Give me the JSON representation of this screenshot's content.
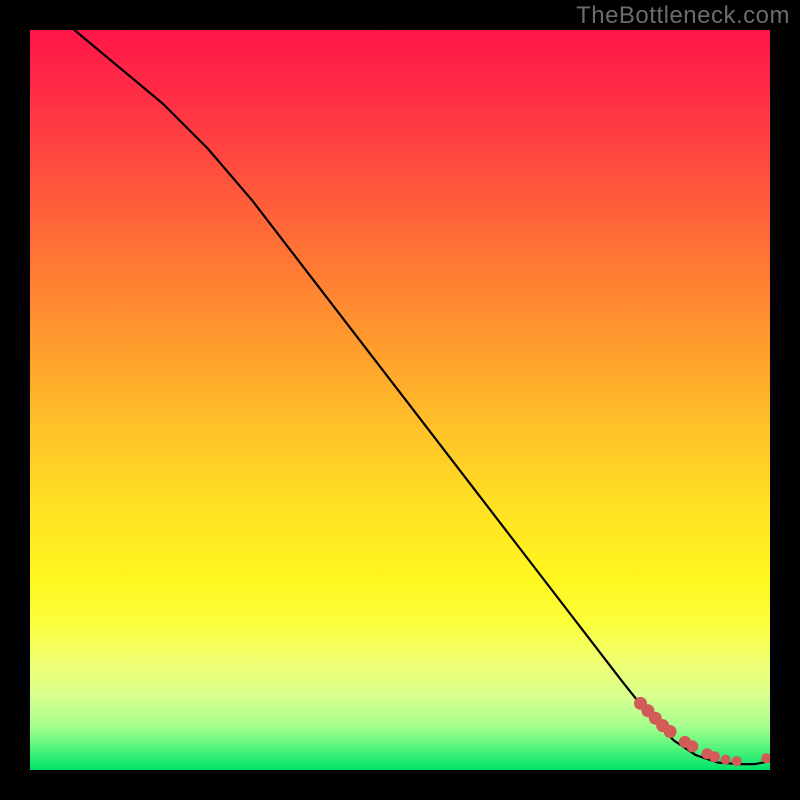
{
  "watermark": "TheBottleneck.com",
  "chart_data": {
    "type": "line",
    "title": "",
    "xlabel": "",
    "ylabel": "",
    "xlim": [
      0,
      100
    ],
    "ylim": [
      0,
      100
    ],
    "series": [
      {
        "name": "curve",
        "x": [
          0,
          6,
          12,
          18,
          24,
          30,
          40,
          50,
          60,
          70,
          80,
          84,
          87,
          90,
          93,
          96,
          98,
          100
        ],
        "y": [
          105,
          100,
          95,
          90,
          84,
          77,
          64,
          51,
          38,
          25,
          12,
          7,
          4,
          2,
          1,
          0.8,
          0.8,
          1.2
        ]
      }
    ],
    "markers": {
      "name": "dots",
      "color": "#d25a57",
      "x": [
        82.5,
        83.5,
        84.5,
        85.5,
        86.5,
        88.5,
        89.5,
        91.5,
        92.5,
        94.0,
        95.5,
        99.5
      ],
      "y": [
        9.0,
        8.0,
        7.0,
        6.0,
        5.2,
        3.8,
        3.2,
        2.2,
        1.8,
        1.4,
        1.2,
        1.6
      ],
      "r": [
        6.5,
        6.5,
        6.5,
        6.5,
        6.5,
        6.0,
        6.0,
        5.5,
        5.5,
        5.0,
        5.0,
        5.0
      ]
    },
    "gradient_stops": [
      {
        "pos": 0.0,
        "color": "#ff1648"
      },
      {
        "pos": 0.4,
        "color": "#ff9a2e"
      },
      {
        "pos": 0.7,
        "color": "#fff61f"
      },
      {
        "pos": 0.9,
        "color": "#d8ff8e"
      },
      {
        "pos": 1.0,
        "color": "#00e36a"
      }
    ]
  }
}
